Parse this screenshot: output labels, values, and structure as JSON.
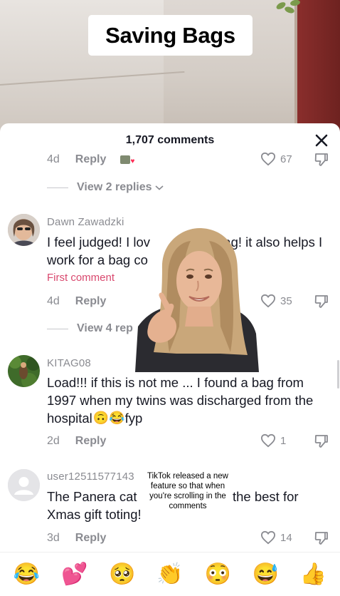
{
  "video": {
    "title": "Saving Bags",
    "overlay_caption": "TikTok released a new feature so that when you're scrolling in the comments"
  },
  "sheet": {
    "comment_count": "1,707 comments"
  },
  "partial_comment": {
    "age": "4d",
    "reply_label": "Reply",
    "likes": "67",
    "view_replies": "View 2 replies"
  },
  "comments": [
    {
      "username": "Dawn Zawadzki",
      "text_line1": "I feel judged! I lov",
      "text_line1b": "bag! it also helps I",
      "text_line2": "work for a bag co",
      "badge": "First comment",
      "age": "4d",
      "reply_label": "Reply",
      "likes": "35",
      "view_replies": "View 4 rep"
    },
    {
      "username": "KITAG08",
      "text_line1": "Load!!! if this is not me ... I found a bag from",
      "text_line2": "1997 when my twins was discharged from the",
      "text_line3": "hospital",
      "text_line3_tail": "fyp",
      "age": "2d",
      "reply_label": "Reply",
      "likes": "1"
    },
    {
      "username": "user12511577143",
      "text_line1a": "The Panera cat",
      "text_line1b": "the best for",
      "text_line2": "Xmas gift toting!",
      "age": "3d",
      "reply_label": "Reply",
      "likes": "14"
    }
  ],
  "emoji_bar": [
    "😂",
    "💕",
    "🥺",
    "👏",
    "😳",
    "😅",
    "👍"
  ],
  "colors": {
    "accent_pink": "#d9486e",
    "muted_text": "#8a8b91",
    "primary_text": "#161823"
  }
}
